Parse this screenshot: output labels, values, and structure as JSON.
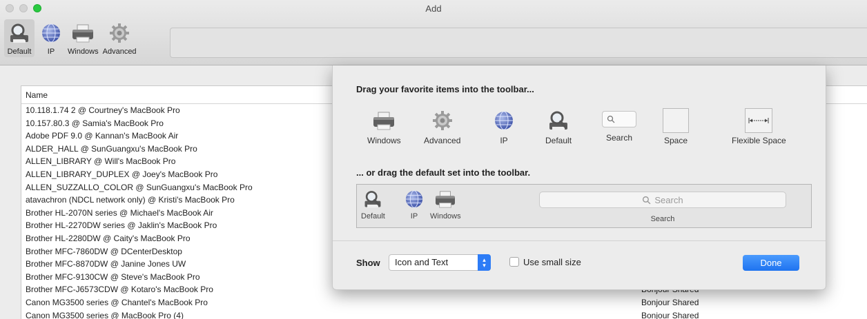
{
  "window": {
    "title": "Add"
  },
  "toolbar": {
    "items": [
      {
        "label": "Default",
        "icon": "default-printer-magnifier-icon",
        "selected": true
      },
      {
        "label": "IP",
        "icon": "globe-icon"
      },
      {
        "label": "Windows",
        "icon": "printer-icon"
      },
      {
        "label": "Advanced",
        "icon": "gear-icon"
      }
    ]
  },
  "list": {
    "column_name": "Name",
    "rows": [
      {
        "name": "10.118.1.74 2 @ Courtney's MacBook Pro",
        "kind": ""
      },
      {
        "name": "10.157.80.3 @ Samia's MacBook Pro",
        "kind": ""
      },
      {
        "name": "Adobe PDF 9.0 @ Kannan's MacBook Air",
        "kind": ""
      },
      {
        "name": "ALDER_HALL @ SunGuangxu's MacBook Pro",
        "kind": ""
      },
      {
        "name": "ALLEN_LIBRARY @ Will's MacBook Pro",
        "kind": ""
      },
      {
        "name": "ALLEN_LIBRARY_DUPLEX @ Joey's MacBook Pro",
        "kind": ""
      },
      {
        "name": "ALLEN_SUZZALLO_COLOR @ SunGuangxu's MacBook Pro",
        "kind": ""
      },
      {
        "name": "atavachron (NDCL network only) @ Kristi's MacBook Pro",
        "kind": ""
      },
      {
        "name": "Brother HL-2070N series @ Michael's MacBook Air",
        "kind": ""
      },
      {
        "name": "Brother HL-2270DW series @ Jaklin's MacBook Pro",
        "kind": ""
      },
      {
        "name": "Brother HL-2280DW @ Caity's MacBook Pro",
        "kind": ""
      },
      {
        "name": "Brother MFC-7860DW @ DCenterDesktop",
        "kind": ""
      },
      {
        "name": "Brother MFC-8870DW @ Janine Jones UW",
        "kind": ""
      },
      {
        "name": "Brother MFC-9130CW @ Steve's MacBook Pro",
        "kind": ""
      },
      {
        "name": "Brother MFC-J6573CDW @ Kotaro's MacBook Pro",
        "kind": "Bonjour Shared"
      },
      {
        "name": "Canon MG3500 series @ Chantel's MacBook Pro",
        "kind": "Bonjour Shared"
      },
      {
        "name": "Canon MG3500 series @ MacBook Pro (4)",
        "kind": "Bonjour Shared"
      }
    ]
  },
  "sheet": {
    "favorites_heading": "Drag your favorite items into the toolbar...",
    "favorites": [
      {
        "label": "Windows",
        "icon": "printer-icon"
      },
      {
        "label": "Advanced",
        "icon": "gear-icon"
      },
      {
        "label": "IP",
        "icon": "globe-icon"
      },
      {
        "label": "Default",
        "icon": "default-printer-magnifier-icon"
      },
      {
        "label": "Search",
        "icon": "search-field-icon"
      },
      {
        "label": "Space",
        "icon": "space-icon"
      },
      {
        "label": "Flexible Space",
        "icon": "flexible-space-icon"
      }
    ],
    "default_heading": "... or drag the default set into the toolbar.",
    "default_set": [
      {
        "label": "Default",
        "icon": "default-printer-magnifier-icon"
      },
      {
        "label": "IP",
        "icon": "globe-icon"
      },
      {
        "label": "Windows",
        "icon": "printer-icon"
      }
    ],
    "default_search_placeholder": "Search",
    "default_search_label": "Search",
    "show_label": "Show",
    "show_value": "Icon and Text",
    "small_size_label": "Use small size",
    "small_size_checked": false,
    "done_label": "Done",
    "accent_color": "#2d7cf6"
  }
}
